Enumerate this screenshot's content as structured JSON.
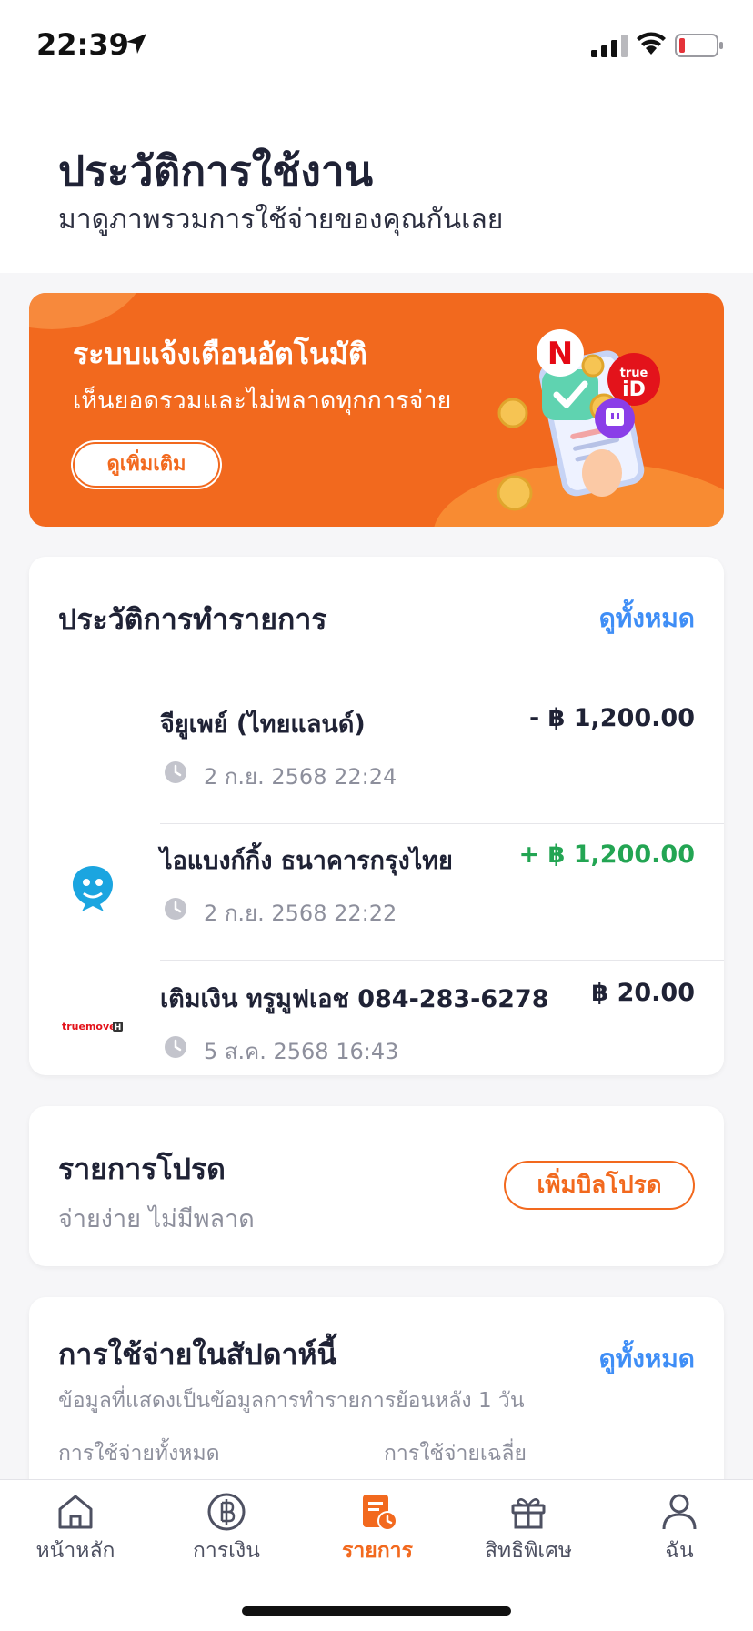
{
  "status_bar": {
    "time": "22:39"
  },
  "header": {
    "title": "ประวัติการใช้งาน",
    "subtitle": "มาดูภาพรวมการใช้จ่ายของคุณกันเลย"
  },
  "promo": {
    "title": "ระบบแจ้งเตือนอัตโนมัติ",
    "subtitle": "เห็นยอดรวมและไม่พลาดทุกการจ่าย",
    "button": "ดูเพิ่มเติม",
    "badges": {
      "netflix": "N",
      "trueid_top": "true",
      "trueid_bottom": "iD"
    }
  },
  "history": {
    "title": "ประวัติการทำรายการ",
    "see_all": "ดูทั้งหมด",
    "transactions": [
      {
        "name": "จียูเพย์ (ไทยแลนด์)",
        "date": "2 ก.ย. 2568 22:24",
        "amount": "- ฿ 1,200.00",
        "type": "negative",
        "logo": "none"
      },
      {
        "name": "ไอแบงก์กิ้ง ธนาคารกรุงไทย",
        "date": "2 ก.ย. 2568 22:22",
        "amount": "+ ฿ 1,200.00",
        "type": "positive",
        "logo": "krungthai-logo"
      },
      {
        "name": "เติมเงิน ทรูมูฟเอช 084-283-6278",
        "date": "5 ส.ค. 2568 16:43",
        "amount": "฿ 20.00",
        "type": "negative",
        "logo": "truemove-logo",
        "logo_text": "truemove",
        "logo_badge": "H"
      }
    ]
  },
  "favorites": {
    "title": "รายการโปรด",
    "subtitle": "จ่ายง่าย ไม่มีพลาด",
    "button": "เพิ่มบิลโปรด"
  },
  "weekly": {
    "title": "การใช้จ่ายในสัปดาห์นี้",
    "see_all": "ดูทั้งหมด",
    "note": "ข้อมูลที่แสดงเป็นข้อมูลการทำรายการย้อนหลัง 1 วัน",
    "total_label": "การใช้จ่ายทั้งหมด",
    "average_label": "การใช้จ่ายเฉลี่ย"
  },
  "nav": {
    "items": [
      {
        "label": "หน้าหลัก",
        "icon": "home-icon"
      },
      {
        "label": "การเงิน",
        "icon": "baht-icon"
      },
      {
        "label": "รายการ",
        "icon": "transactions-icon",
        "active": true
      },
      {
        "label": "สิทธิพิเศษ",
        "icon": "gift-icon"
      },
      {
        "label": "ฉัน",
        "icon": "profile-icon"
      }
    ]
  },
  "colors": {
    "accent": "#f2691e",
    "link": "#3f8ef6",
    "positive": "#23a553",
    "text": "#1f2235",
    "muted": "#8d8f9c"
  }
}
